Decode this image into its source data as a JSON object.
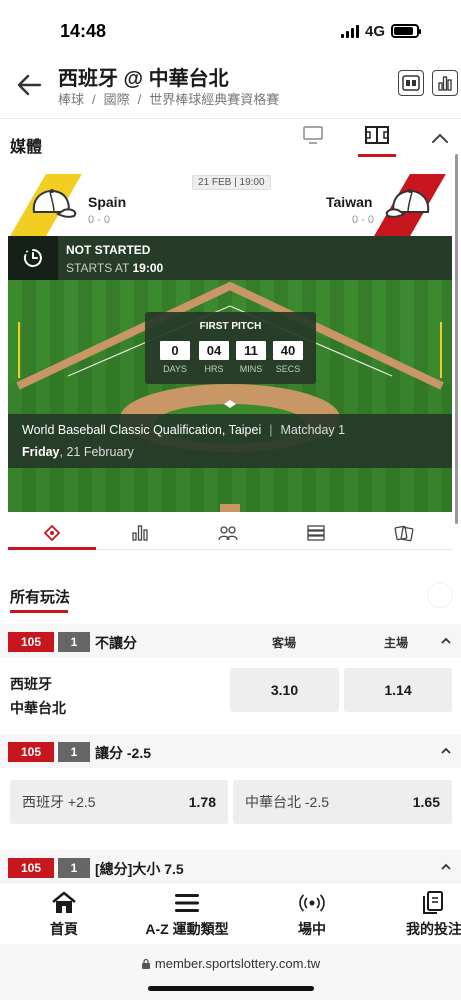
{
  "status_bar": {
    "time": "14:48",
    "network": "4G"
  },
  "header": {
    "title": "西班牙 @ 中華台北",
    "breadcrumb": [
      "棒球",
      "國際",
      "世界棒球經典賽資格賽"
    ]
  },
  "media": {
    "label": "媒體"
  },
  "match": {
    "date": "21 FEB | 19:00",
    "home": {
      "name": "Spain",
      "score": "0 - 0"
    },
    "away": {
      "name": "Taiwan",
      "score": "0 - 0"
    },
    "status": "NOT STARTED",
    "starts_prefix": "STARTS AT",
    "starts_time": "19:00",
    "countdown": {
      "title": "FIRST PITCH",
      "days": "0",
      "days_label": "DAYS",
      "hrs": "04",
      "hrs_label": "HRS",
      "mins": "11",
      "mins_label": "MINS",
      "secs": "40",
      "secs_label": "SECS"
    },
    "competition": "World Baseball Classic Qualification, Taipei",
    "matchday": "Matchday 1",
    "day": "Friday",
    "date_long": ", 21 February"
  },
  "tabs": [
    "field-view",
    "stats",
    "lineups",
    "standings",
    "cards"
  ],
  "all_markets": {
    "label": "所有玩法"
  },
  "markets": [
    {
      "code": "105",
      "num": "1",
      "name": "不讓分",
      "col_away": "客場",
      "col_home": "主場",
      "team1": "西班牙",
      "team2": "中華台北",
      "odds_away": "3.10",
      "odds_home": "1.14"
    },
    {
      "code": "105",
      "num": "1",
      "name": "讓分 -2.5",
      "opt1_label": "西班牙 +2.5",
      "opt1_odds": "1.78",
      "opt2_label": "中華台北 -2.5",
      "opt2_odds": "1.65"
    },
    {
      "code": "105",
      "num": "1",
      "name": "[總分]大小 7.5"
    }
  ],
  "bottom_nav": {
    "home": "首頁",
    "sports": "A-Z 運動類型",
    "live": "場中",
    "bets": "我的投注"
  },
  "browser": {
    "url": "member.sportslottery.com.tw"
  },
  "colors": {
    "accent": "#c8161e",
    "field_green": "#3c8a2e",
    "spain_stripe": "#f3cd22"
  }
}
